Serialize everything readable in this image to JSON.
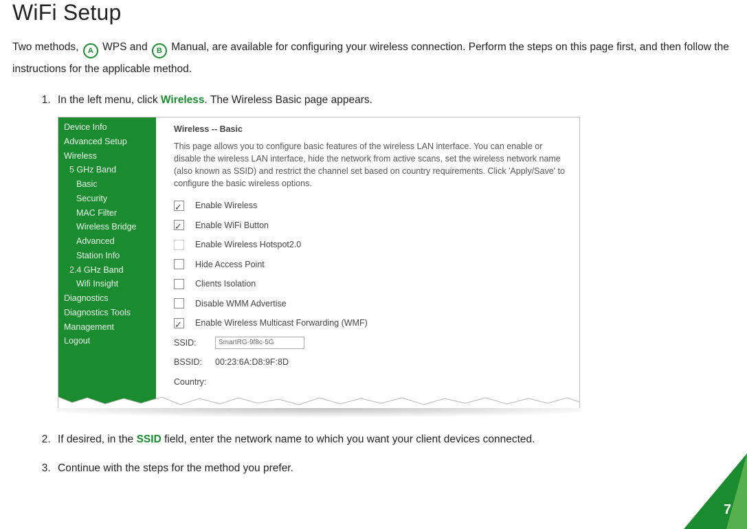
{
  "title": "WiFi Setup",
  "intro": {
    "pre": "Two methods,",
    "badgeA": "A",
    "methodA": " WPS and ",
    "badgeB": "B",
    "methodB": " Manual, are available for configuring your wireless connection. Perform the steps on this page first, and then follow the instructions for the applicable method."
  },
  "steps": {
    "s1": {
      "pre": "In the left menu, click ",
      "em": "Wireless",
      "post": ". The Wireless Basic page appears."
    },
    "s2": {
      "pre": "If desired, in the ",
      "em": "SSID",
      "post": " field, enter the network name to which you want your client devices connected."
    },
    "s3": "Continue with the steps for the method you prefer."
  },
  "menu": [
    {
      "label": "Device Info",
      "indent": 0
    },
    {
      "label": "Advanced Setup",
      "indent": 0
    },
    {
      "label": "Wireless",
      "indent": 0
    },
    {
      "label": "5 GHz Band",
      "indent": 1
    },
    {
      "label": "Basic",
      "indent": 2
    },
    {
      "label": "Security",
      "indent": 2
    },
    {
      "label": "MAC Filter",
      "indent": 2
    },
    {
      "label": "Wireless Bridge",
      "indent": 2
    },
    {
      "label": "Advanced",
      "indent": 2
    },
    {
      "label": "Station Info",
      "indent": 2
    },
    {
      "label": "2.4 GHz Band",
      "indent": 1
    },
    {
      "label": "Wifi Insight",
      "indent": 2
    },
    {
      "label": "Diagnostics",
      "indent": 0
    },
    {
      "label": "Diagnostics Tools",
      "indent": 0
    },
    {
      "label": "Management",
      "indent": 0
    },
    {
      "label": "Logout",
      "indent": 0
    }
  ],
  "panel": {
    "title": "Wireless -- Basic",
    "desc": "This page allows you to configure basic features of the wireless LAN interface. You can enable or disable the wireless LAN interface, hide the network from active scans, set the wireless network name (also known as SSID) and restrict the channel set based on country requirements. Click 'Apply/Save' to configure the basic wireless options.",
    "options": [
      {
        "label": "Enable Wireless",
        "checked": true,
        "dim": false
      },
      {
        "label": "Enable WiFi Button",
        "checked": true,
        "dim": false
      },
      {
        "label": "Enable Wireless Hotspot2.0",
        "checked": false,
        "dim": true
      },
      {
        "label": "Hide Access Point",
        "checked": false,
        "dim": false
      },
      {
        "label": "Clients Isolation",
        "checked": false,
        "dim": false
      },
      {
        "label": "Disable WMM Advertise",
        "checked": false,
        "dim": false
      },
      {
        "label": "Enable Wireless Multicast Forwarding (WMF)",
        "checked": true,
        "dim": false
      }
    ],
    "ssid_label": "SSID:",
    "ssid_value": "SmartRG-9f8c-5G",
    "bssid_label": "BSSID:",
    "bssid_value": "00:23:6A:D8:9F:8D",
    "country_label": "Country:"
  },
  "page_number": "7"
}
